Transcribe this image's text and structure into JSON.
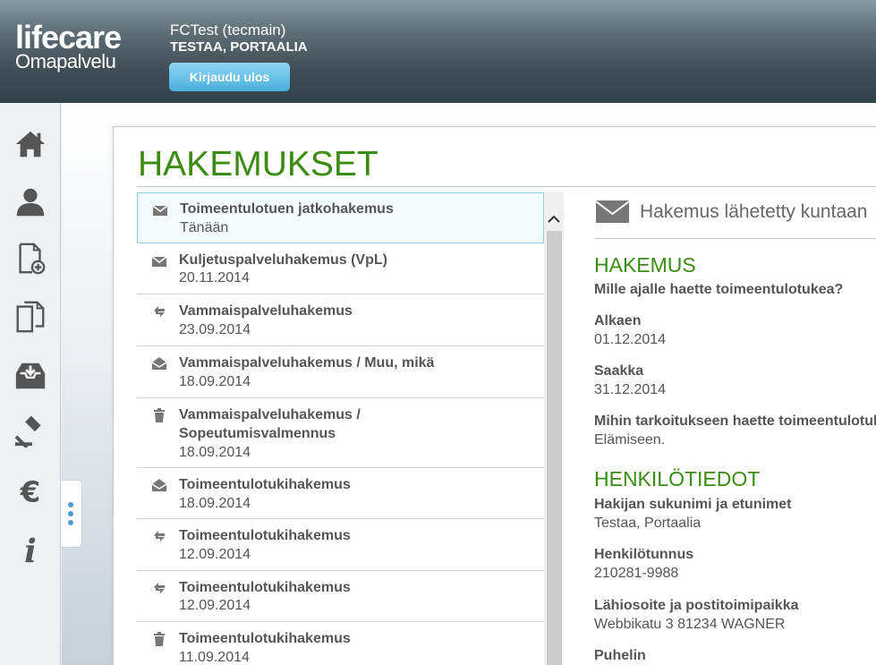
{
  "header": {
    "logo_main": "lifecare",
    "logo_sub": "Omapalvelu",
    "user_name": "FCTest (tecmain)",
    "user_sub": "TESTAA, PORTAALIA",
    "logout_label": "Kirjaudu ulos"
  },
  "nav": {
    "items": [
      "home-icon",
      "person-icon",
      "new-document-icon",
      "documents-icon",
      "inbox-icon",
      "gavel-icon",
      "euro-icon",
      "info-icon"
    ]
  },
  "page": {
    "title": "HAKEMUKSET"
  },
  "applications": [
    {
      "title": "Toimeentulotuen jatkohakemus",
      "date": "Tänään",
      "status_icon": "envelope-icon"
    },
    {
      "title": "Kuljetuspalveluhakemus (VpL)",
      "date": "20.11.2014",
      "status_icon": "envelope-icon"
    },
    {
      "title": "Vammaispalveluhakemus",
      "date": "23.09.2014",
      "status_icon": "exchange-icon"
    },
    {
      "title": "Vammaispalveluhakemus / Muu, mikä",
      "date": "18.09.2014",
      "status_icon": "open-envelope-icon"
    },
    {
      "title_line1": "Vammaispalveluhakemus /",
      "title_line2": "Sopeutumisvalmennus",
      "date": "18.09.2014",
      "status_icon": "trash-icon"
    },
    {
      "title": "Toimeentulotukihakemus",
      "date": "18.09.2014",
      "status_icon": "open-envelope-icon"
    },
    {
      "title": "Toimeentulotukihakemus",
      "date": "12.09.2014",
      "status_icon": "exchange-icon"
    },
    {
      "title": "Toimeentulotukihakemus",
      "date": "12.09.2014",
      "status_icon": "exchange-icon"
    },
    {
      "title": "Toimeentulotukihakemus",
      "date": "11.09.2014",
      "status_icon": "trash-icon"
    }
  ],
  "detail": {
    "status_text": "Hakemus lähetetty kuntaan",
    "section1_title": "HAKEMUS",
    "q_period": "Mille ajalle haette toimeentulotukea?",
    "start_label": "Alkaen",
    "start_value": "01.12.2014",
    "end_label": "Saakka",
    "end_value": "31.12.2014",
    "purpose_label": "Mihin tarkoitukseen haette toimeentulotukea?",
    "purpose_value": "Elämiseen.",
    "section2_title": "HENKILÖTIEDOT",
    "name_label": "Hakijan sukunimi ja etunimet",
    "name_value": "Testaa, Portaalia",
    "ssn_label": "Henkilötunnus",
    "ssn_value": "210281-9988",
    "address_label": "Lähiosoite ja postitoimipaikka",
    "address_value": "Webbikatu 3 81234 WAGNER",
    "phone_label": "Puhelin"
  },
  "colors": {
    "accent_green": "#3a8c12",
    "header_dark": "#3e4c53",
    "button_blue": "#4ab0dd"
  }
}
